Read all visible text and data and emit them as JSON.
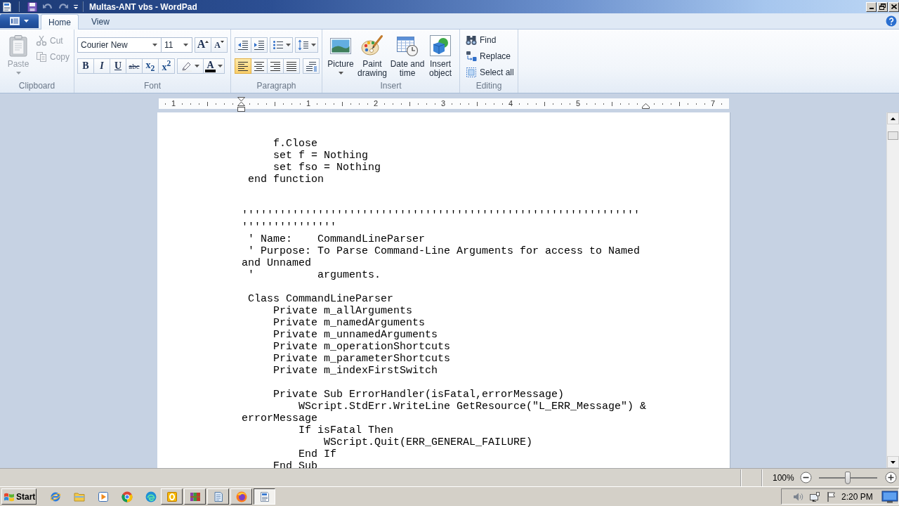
{
  "window": {
    "title": "Multas-ANT vbs - WordPad"
  },
  "ribbon": {
    "tabs": [
      {
        "label": "Home",
        "selected": true
      },
      {
        "label": "View",
        "selected": false
      }
    ],
    "clipboard": {
      "label": "Clipboard",
      "paste": {
        "label": "Paste",
        "disabled": true,
        "dropdown": true
      },
      "actions": [
        {
          "label": "Cut",
          "kind": "cut",
          "disabled": true
        },
        {
          "label": "Copy",
          "kind": "copy",
          "disabled": true
        }
      ]
    },
    "font": {
      "label": "Font",
      "family": "Courier New",
      "size": "11",
      "size_buttons": [
        {
          "label": "A",
          "kind": "grow"
        },
        {
          "label": "A",
          "kind": "shrink"
        }
      ],
      "style_buttons": [
        {
          "label": "B",
          "kind": "bold"
        },
        {
          "label": "I",
          "kind": "italic"
        },
        {
          "label": "U",
          "kind": "underline"
        },
        {
          "label": "abc",
          "kind": "strikethrough"
        },
        {
          "label": "x$_{2}$",
          "kind": "subscript"
        },
        {
          "label": "x$^{2}$",
          "kind": "superscript"
        }
      ],
      "color_button": {
        "label": "A"
      }
    },
    "paragraph": {
      "label": "Paragraph",
      "alignment": [
        {
          "kind": "left",
          "selected": true
        },
        {
          "kind": "center",
          "selected": false
        },
        {
          "kind": "right",
          "selected": false
        },
        {
          "kind": "justify",
          "selected": false
        }
      ]
    },
    "insert": {
      "label": "Insert",
      "items": [
        {
          "label": "Picture",
          "kind": "picture",
          "dropdown": true
        },
        {
          "label": "Paint drawing",
          "kind": "paint",
          "dropdown": false
        },
        {
          "label": "Date and time",
          "kind": "datetime",
          "dropdown": false
        },
        {
          "label": "Insert object",
          "kind": "object",
          "dropdown": false
        }
      ]
    },
    "editing": {
      "label": "Editing",
      "items": [
        {
          "label": "Find",
          "kind": "find"
        },
        {
          "label": "Replace",
          "kind": "replace"
        },
        {
          "label": "Select all",
          "kind": "select_all"
        }
      ]
    }
  },
  "ruler": {
    "labels": [
      "1",
      "1",
      "2",
      "3",
      "4",
      "5",
      "7"
    ]
  },
  "document": {
    "lines": [
      {
        "kind": "code",
        "text": "     f.Close"
      },
      {
        "kind": "code",
        "text": "     set f = Nothing"
      },
      {
        "kind": "code",
        "text": "     set fso = Nothing"
      },
      {
        "kind": "code",
        "text": " end function"
      },
      {
        "kind": "blank"
      },
      {
        "kind": "blank"
      },
      {
        "kind": "code",
        "text": "'''''''''''''''''''''''''''''''''''''''''''''''''''''''''''''''"
      },
      {
        "kind": "code",
        "text": "'''''''''''''''"
      },
      {
        "kind": "code",
        "text": " ' Name:    CommandLineParser"
      },
      {
        "kind": "code",
        "text": " ' Purpose: To Parse Command-Line Arguments for access to Named"
      },
      {
        "kind": "code",
        "text": "and Unnamed"
      },
      {
        "kind": "code",
        "text": " '          arguments."
      },
      {
        "kind": "blank"
      },
      {
        "kind": "code",
        "text": " Class CommandLineParser"
      },
      {
        "kind": "code",
        "text": "     Private m_allArguments"
      },
      {
        "kind": "code",
        "text": "     Private m_namedArguments"
      },
      {
        "kind": "code",
        "text": "     Private m_unnamedArguments"
      },
      {
        "kind": "code",
        "text": "     Private m_operationShortcuts"
      },
      {
        "kind": "code",
        "text": "     Private m_parameterShortcuts"
      },
      {
        "kind": "code",
        "text": "     Private m_indexFirstSwitch"
      },
      {
        "kind": "blank"
      },
      {
        "kind": "code",
        "text": "     Private Sub ErrorHandler(isFatal,errorMessage)"
      },
      {
        "kind": "code",
        "text": "         WScript.StdErr.WriteLine GetResource(\"L_ERR_Message\") &"
      },
      {
        "kind": "code",
        "text": "errorMessage"
      },
      {
        "kind": "code",
        "text": "         If isFatal Then"
      },
      {
        "kind": "code",
        "text": "             WScript.Quit(ERR_GENERAL_FAILURE)"
      },
      {
        "kind": "code",
        "text": "         End If"
      },
      {
        "kind": "code",
        "text": "     End Sub"
      }
    ]
  },
  "status_bar": {
    "zoom": "100%",
    "zoom_slider": {
      "level": 0.5
    }
  },
  "taskbar": {
    "start": "Start",
    "quick_launch": [
      {
        "kind": "ie"
      },
      {
        "kind": "explorer"
      },
      {
        "kind": "media"
      },
      {
        "kind": "chrome"
      },
      {
        "kind": "edge"
      }
    ],
    "tasks": [
      {
        "kind": "outlook",
        "selected": false
      },
      {
        "kind": "winrar",
        "selected": false
      },
      {
        "kind": "notepad",
        "selected": false
      },
      {
        "kind": "firefox",
        "selected": false
      },
      {
        "kind": "wordpad",
        "selected": true
      }
    ],
    "clock": "2:20 PM"
  }
}
